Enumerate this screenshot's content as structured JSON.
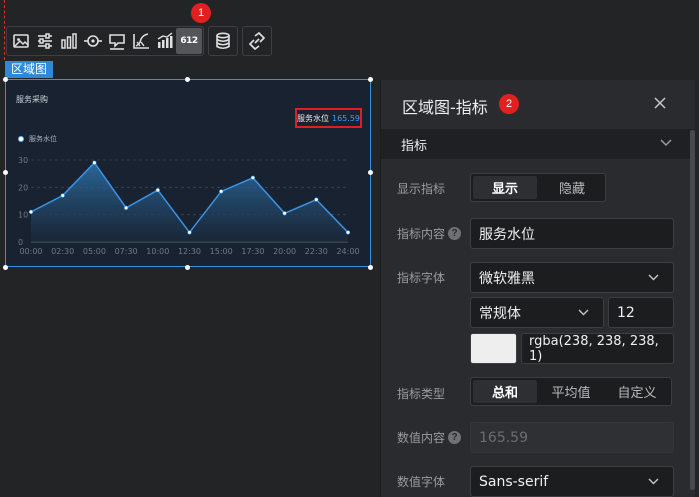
{
  "toolbar": {
    "badge": "1",
    "buttons": [
      {
        "icon": "image-icon"
      },
      {
        "icon": "sliders-icon"
      },
      {
        "icon": "bar-chart-icon"
      },
      {
        "icon": "target-icon"
      },
      {
        "icon": "flag-icon"
      },
      {
        "icon": "axis-curve-icon"
      },
      {
        "icon": "bar-trend-icon"
      },
      {
        "icon": "number-icon",
        "text": "612",
        "active": true
      },
      {
        "icon": "database-icon"
      },
      {
        "icon": "link-icon"
      }
    ]
  },
  "component": {
    "tag": "区域图",
    "title": "服务采购",
    "metric_label": "服务水位",
    "metric_value": "165.59",
    "legend": "服务水位"
  },
  "chart_data": {
    "type": "area",
    "title": "服务采购",
    "series": [
      {
        "name": "服务水位",
        "values": [
          11,
          17,
          29,
          12.5,
          19,
          3.5,
          18.5,
          23.5,
          10.5,
          15.5,
          3.5
        ]
      }
    ],
    "x": [
      "00:00",
      "02:30",
      "05:00",
      "07:30",
      "10:00",
      "12:30",
      "15:00",
      "17:30",
      "20:00",
      "22:30",
      "24:00"
    ],
    "yticks": [
      0,
      10,
      20,
      30
    ],
    "ylim": [
      0,
      30
    ],
    "colors": {
      "line": "#3b93e6",
      "fill_top": "#2c6fa8",
      "fill_bottom": "#1a2a3c",
      "point": "#ffffff"
    }
  },
  "panel": {
    "title": "区域图-指标",
    "badge": "2",
    "section": "指标",
    "show_label": "显示指标",
    "show_options": [
      "显示",
      "隐藏"
    ],
    "content_label": "指标内容",
    "content_value": "服务水位",
    "font_label": "指标字体",
    "font_family": "微软雅黑",
    "font_style": "常规体",
    "font_size": "12",
    "font_color": "rgba(238, 238, 238, 1)",
    "type_label": "指标类型",
    "type_options": [
      "总和",
      "平均值",
      "自定义"
    ],
    "value_label": "数值内容",
    "value_value": "165.59",
    "value_font_label": "数值字体",
    "value_font": "Sans-serif"
  },
  "colors": {
    "accent": "#3b8fe0",
    "badge": "#e32020",
    "highlight": "#e02020"
  }
}
